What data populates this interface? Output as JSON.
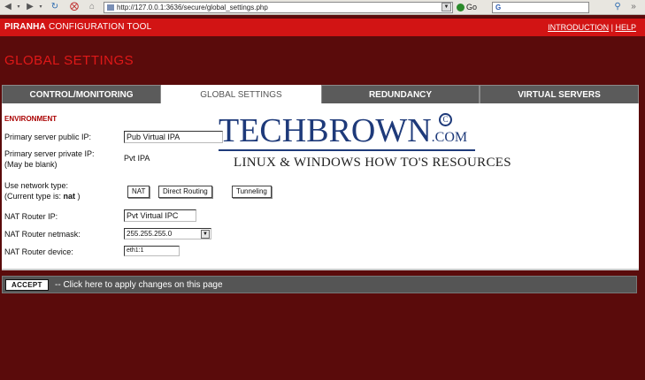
{
  "browser": {
    "url": "http://127.0.0.1:3636/secure/global_settings.php",
    "go_label": "Go",
    "search_value": "G",
    "icons": [
      "back-icon",
      "forward-icon",
      "reload-icon",
      "stop-icon",
      "home-icon",
      "favicon-icon"
    ]
  },
  "header": {
    "app_title_bold": "PIRANHA",
    "app_title_rest": " CONFIGURATION TOOL",
    "links": [
      "INTRODUCTION",
      "HELP"
    ],
    "link_separator": " | "
  },
  "page": {
    "title": "GLOBAL SETTINGS"
  },
  "tabs": [
    {
      "label": "CONTROL/MONITORING",
      "active": false
    },
    {
      "label": "GLOBAL SETTINGS",
      "active": true
    },
    {
      "label": "REDUNDANCY",
      "active": false
    },
    {
      "label": "VIRTUAL SERVERS",
      "active": false
    }
  ],
  "form": {
    "section": "ENVIRONMENT",
    "public_ip_label": "Primary server public IP:",
    "public_ip_value": "Pub Virtual IPA",
    "private_ip_label": "Primary server private IP:",
    "private_ip_note": "(May be blank)",
    "private_ip_value": "Pvt   IPA",
    "network_type_label": "Use network type:",
    "network_type_current_prefix": "(Current type is: ",
    "network_type_current": "nat",
    "network_type_current_suffix": " )",
    "network_buttons": [
      "NAT",
      "Direct Routing",
      "Tunneling"
    ],
    "nat_router_ip_label": "NAT Router IP:",
    "nat_router_ip_value": "Pvt Virtual IPC",
    "nat_router_netmask_label": "NAT Router netmask:",
    "nat_router_netmask_value": "255.255.255.0",
    "nat_router_device_label": "NAT Router device:",
    "nat_router_device_value": "eth1:1"
  },
  "watermark": {
    "word_big": "TECH",
    "word_rest": "BROWN",
    "word_suffix": ".COM",
    "registered": "C",
    "tagline": "LINUX & WINDOWS HOW TO'S RESOURCES"
  },
  "accept": {
    "button_label": "ACCEPT",
    "text": "-- Click here to apply changes on this page"
  },
  "colors": {
    "background": "#5a0b0b",
    "header": "#d21414",
    "title": "#e01818",
    "tab_inactive": "#5b5b5b",
    "logo": "#1e3a7a"
  }
}
